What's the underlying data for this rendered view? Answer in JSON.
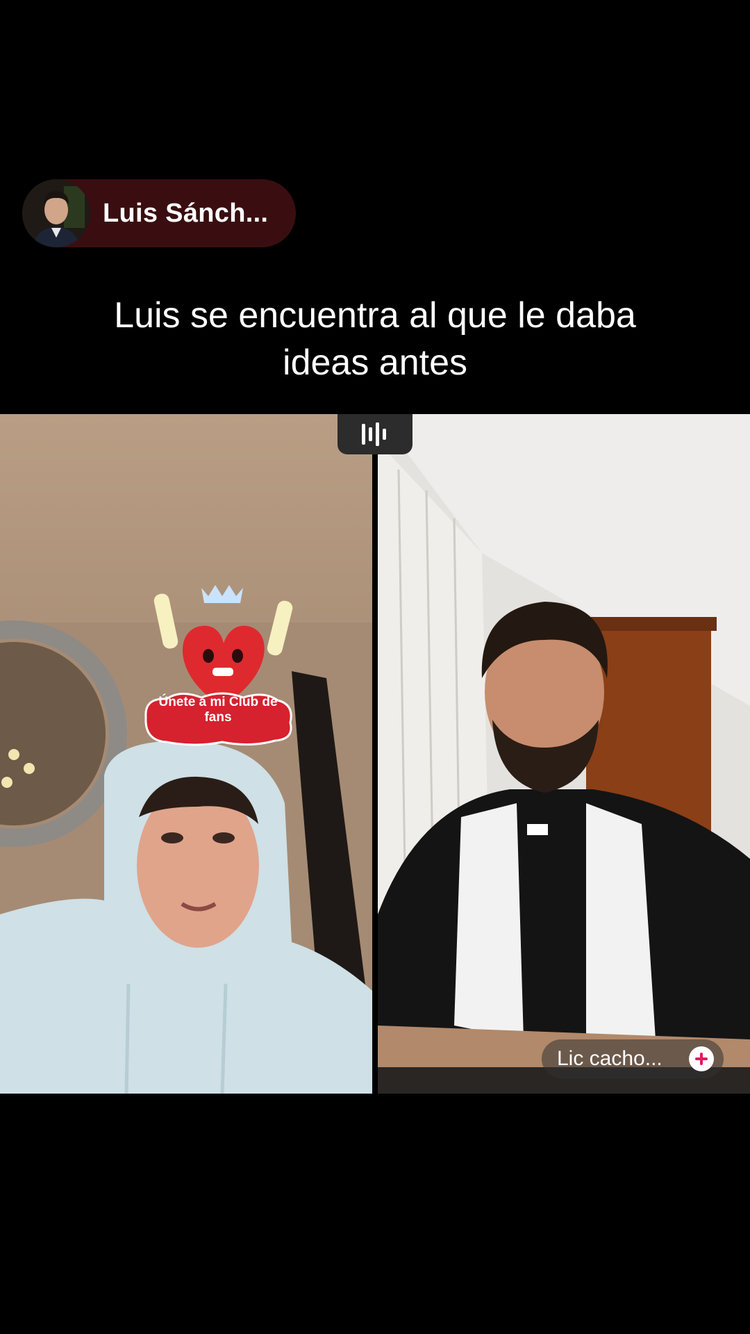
{
  "host": {
    "name": "Luis Sánch...",
    "avatar_icon": "profile-photo"
  },
  "caption": {
    "line1": "Luis se encuentra al que le daba",
    "line2": "ideas antes"
  },
  "live": {
    "audio_icon": "audio-bars-icon",
    "left_effect_text_line1": "Únete a mi Club de",
    "left_effect_text_line2": "fans",
    "guest_name": "Lic cacho...",
    "follow_icon": "plus-icon"
  },
  "colors": {
    "host_pill": "#3a0e10",
    "follow_plus": "#e8175d",
    "badge_red": "#d6212e"
  }
}
